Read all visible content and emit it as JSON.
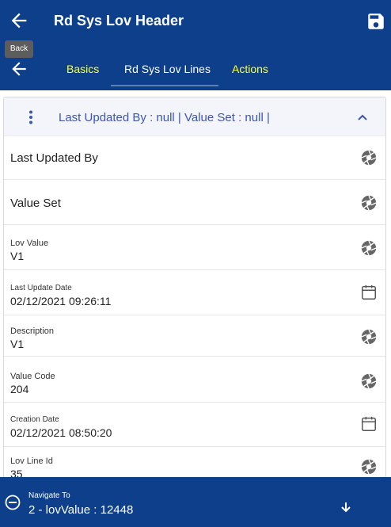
{
  "header": {
    "title": "Rd Sys Lov Header",
    "back_tooltip": "Back"
  },
  "tabs": [
    {
      "label": "Basics",
      "active": false
    },
    {
      "label": "Rd Sys Lov Lines",
      "active": true
    },
    {
      "label": "Actions",
      "active": false
    }
  ],
  "card": {
    "summary": "Last Updated By  : null | Value Set  : null |"
  },
  "fields": {
    "last_updated_by": {
      "label": "Last Updated By"
    },
    "value_set": {
      "label": "Value Set"
    },
    "lov_value": {
      "label": "Lov Value",
      "value": "V1"
    },
    "last_update_date": {
      "label": "Last Update Date",
      "value": "02/12/2021 09:26:11"
    },
    "description": {
      "label": "Description",
      "value": "V1"
    },
    "value_code": {
      "label": "Value Code",
      "value": "204"
    },
    "creation_date": {
      "label": "Creation Date",
      "value": "02/12/2021 08:50:20"
    },
    "lov_line_id": {
      "label": "Lov Line Id",
      "value": "35"
    }
  },
  "navigate": {
    "label": "Navigate To",
    "value": "2 - lovValue : 12448"
  },
  "icons": {
    "back": "arrow-left-icon",
    "save": "save-icon",
    "kebab": "kebab-icon",
    "collapse": "chevron-up-icon",
    "field": "camera-shutter-icon",
    "calendar": "calendar-icon",
    "minus": "minus-circle-icon",
    "down": "arrow-down-icon"
  },
  "colors": {
    "primary": "#0d3f8a",
    "tab_inactive": "#ffff3a",
    "accent": "#3b55b2"
  }
}
